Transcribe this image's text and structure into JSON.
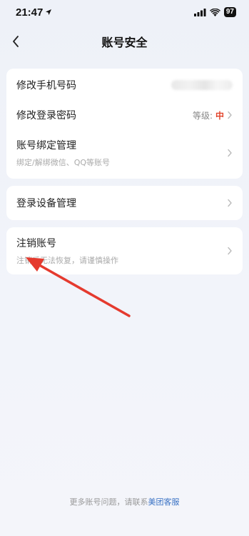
{
  "status_bar": {
    "time": "21:47",
    "battery": "97"
  },
  "nav": {
    "title": "账号安全"
  },
  "section1": {
    "phone": {
      "title": "修改手机号码"
    },
    "password": {
      "title": "修改登录密码",
      "level_label": "等级:",
      "level_value": "中"
    },
    "binding": {
      "title": "账号绑定管理",
      "subtitle": "绑定/解绑微信、QQ等账号"
    }
  },
  "section2": {
    "devices": {
      "title": "登录设备管理"
    }
  },
  "section3": {
    "deactivate": {
      "title": "注销账号",
      "subtitle": "注销后无法恢复，请谨慎操作"
    }
  },
  "footer": {
    "text": "更多账号问题，请联系",
    "link": "美团客服"
  },
  "colors": {
    "accent_red": "#e2452c",
    "link_blue": "#3a72c4",
    "annotation_arrow": "#e53a2e"
  }
}
